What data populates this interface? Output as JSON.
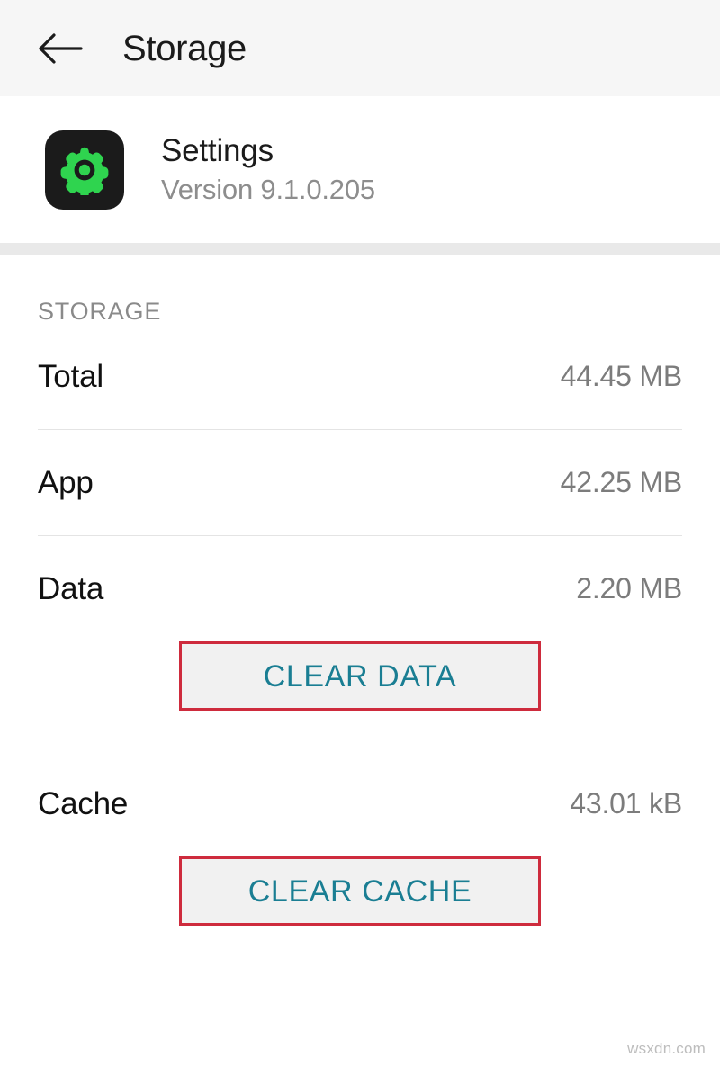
{
  "header": {
    "title": "Storage",
    "back_icon": "arrow-left-icon"
  },
  "app": {
    "name": "Settings",
    "version": "Version 9.1.0.205",
    "icon": "gear-icon",
    "icon_bg_color": "#1b1b1b",
    "icon_glyph_color": "#2fd44f"
  },
  "storage_section": {
    "title": "STORAGE",
    "rows": [
      {
        "label": "Total",
        "value": "44.45 MB"
      },
      {
        "label": "App",
        "value": "42.25 MB"
      },
      {
        "label": "Data",
        "value": "2.20 MB"
      },
      {
        "label": "Cache",
        "value": "43.01 kB"
      }
    ]
  },
  "actions": {
    "clear_data_label": "CLEAR DATA",
    "clear_cache_label": "CLEAR CACHE",
    "accent_color": "#1a7e93",
    "highlight_color": "#ce2b3d"
  },
  "watermark": {
    "text": "wsxdn.com"
  }
}
